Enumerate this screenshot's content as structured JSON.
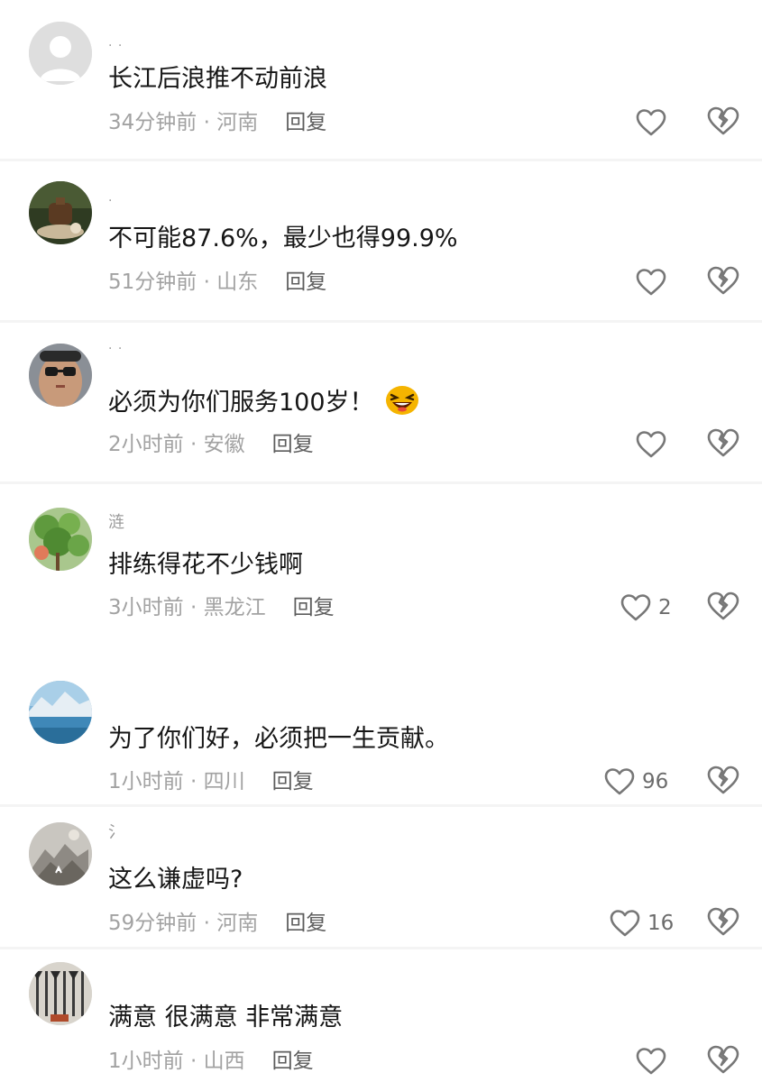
{
  "comments": [
    {
      "username": "·  ·",
      "text": "长江后浪推不动前浪",
      "time": "34分钟前 · 河南",
      "reply_label": "回复",
      "likes": "",
      "avatar_icon": "default-user-icon"
    },
    {
      "username": "·",
      "text": "不可能87.6%，最少也得99.9%",
      "time": "51分钟前 · 山东",
      "reply_label": "回复",
      "likes": "",
      "avatar_icon": "teapot-photo-icon"
    },
    {
      "username": "·  ·",
      "text": "必须为你们服务100岁！",
      "time": "2小时前 · 安徽",
      "reply_label": "回复",
      "likes": "",
      "avatar_icon": "man-glasses-photo-icon",
      "emoji_icon": "laughing-emoji-icon"
    },
    {
      "username": "涟",
      "text": "排练得花不少钱啊",
      "time": "3小时前 · 黑龙江",
      "reply_label": "回复",
      "likes": "2",
      "avatar_icon": "green-plant-photo-icon"
    },
    {
      "username": "",
      "text": "为了你们好，必须把一生贡献。",
      "time": "1小时前 · 四川",
      "reply_label": "回复",
      "likes": "96",
      "avatar_icon": "glacier-landscape-photo-icon"
    },
    {
      "username": "氵",
      "text": "这么谦虚吗?",
      "time": "59分钟前 · 河南",
      "reply_label": "回复",
      "likes": "16",
      "avatar_icon": "ink-painting-photo-icon"
    },
    {
      "username": "",
      "text": "满意 很满意 非常满意",
      "time": "1小时前 · 山西",
      "reply_label": "回复",
      "likes": "",
      "avatar_icon": "weapons-rack-photo-icon"
    }
  ],
  "colors": {
    "text": "#161616",
    "meta": "#a2a2a2",
    "reply": "#5d5d5d",
    "icon": "#777777"
  }
}
